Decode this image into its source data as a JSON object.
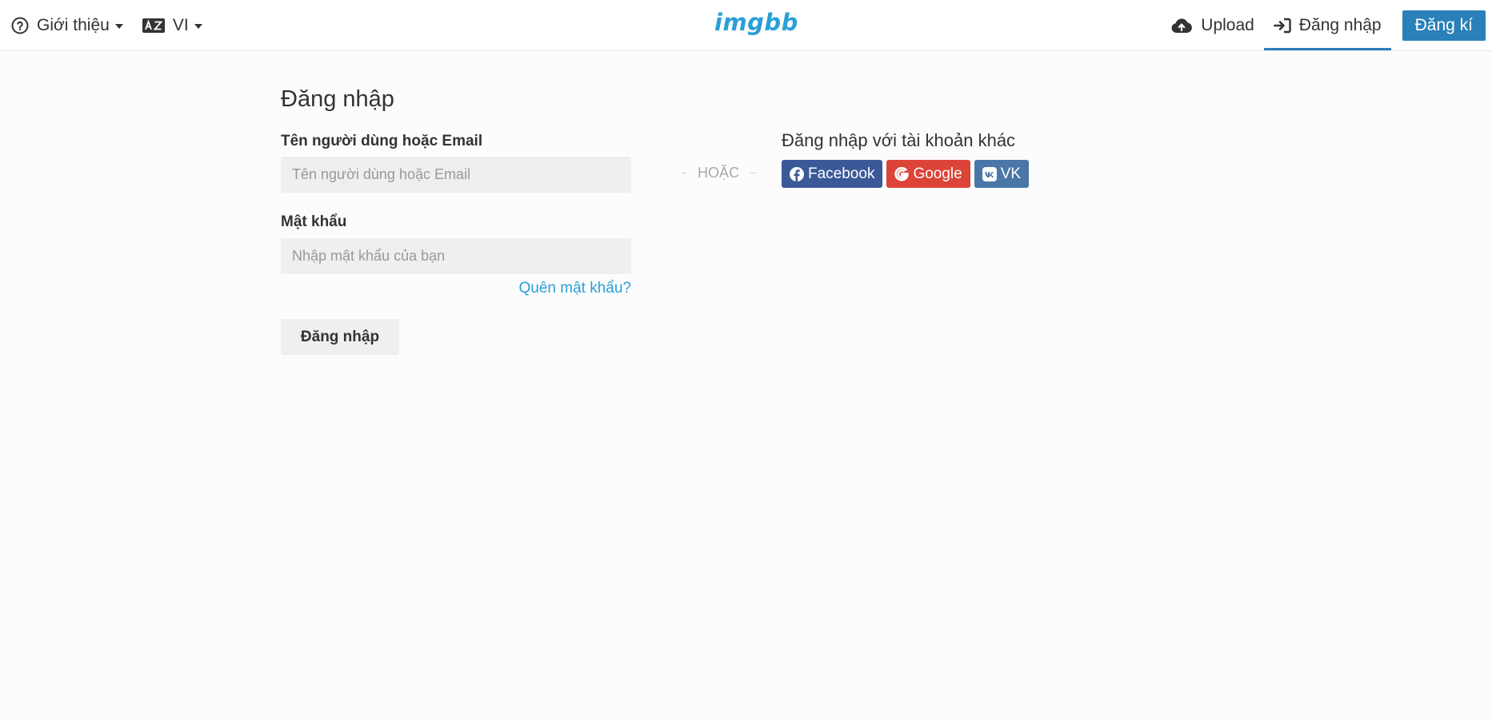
{
  "header": {
    "about_label": "Giới thiệu",
    "lang_label": "VI",
    "logo_text": "imgbb",
    "upload_label": "Upload",
    "login_label": "Đăng nhập",
    "signup_label": "Đăng kí"
  },
  "form": {
    "title": "Đăng nhập",
    "username_label": "Tên người dùng hoặc Email",
    "username_placeholder": "Tên người dùng hoặc Email",
    "password_label": "Mật khẩu",
    "password_placeholder": "Nhập mật khẩu của bạn",
    "forgot_label": "Quên mật khẩu?",
    "submit_label": "Đăng nhập"
  },
  "separator": {
    "label": "HOẶC"
  },
  "social": {
    "title": "Đăng nhập với tài khoản khác",
    "buttons": [
      {
        "label": "Facebook",
        "icon": "facebook-icon",
        "color": "#3b5998"
      },
      {
        "label": "Google",
        "icon": "google-icon",
        "color": "#db4437"
      },
      {
        "label": "VK",
        "icon": "vk-icon",
        "color": "#4a76a8"
      }
    ]
  },
  "colors": {
    "accent": "#2a80b9",
    "link": "#2a9fd8",
    "logo": "#2a9fd8"
  }
}
